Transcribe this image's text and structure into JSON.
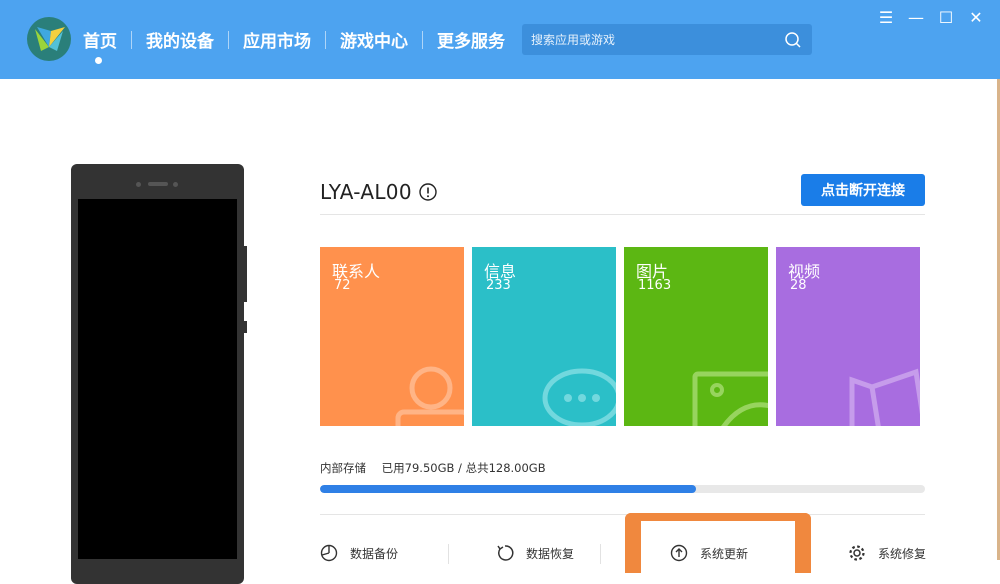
{
  "nav": {
    "items": [
      {
        "label": "首页"
      },
      {
        "label": "我的设备"
      },
      {
        "label": "应用市场"
      },
      {
        "label": "游戏中心"
      },
      {
        "label": "更多服务"
      }
    ]
  },
  "search": {
    "placeholder": "搜索应用或游戏"
  },
  "window_controls": {
    "menu": "☰",
    "minimize": "—",
    "maximize": "☐",
    "close": "✕"
  },
  "device": {
    "name": "LYA-AL00",
    "disconnect_label": "点击断开连接"
  },
  "tiles": [
    {
      "label": "联系人",
      "count": "72",
      "color": "#ff914d"
    },
    {
      "label": "信息",
      "count": "233",
      "color": "#2bbfc8"
    },
    {
      "label": "图片",
      "count": "1163",
      "color": "#5cb713"
    },
    {
      "label": "视频",
      "count": "28",
      "color": "#a86de0"
    }
  ],
  "storage": {
    "label": "内部存储",
    "usage": "已用79.50GB / 总共128.00GB",
    "used_fraction": 0.621
  },
  "tools": [
    {
      "label": "数据备份",
      "icon": "backup-icon"
    },
    {
      "label": "数据恢复",
      "icon": "restore-icon"
    },
    {
      "label": "系统更新",
      "icon": "update-icon"
    },
    {
      "label": "系统修复",
      "icon": "repair-icon"
    }
  ],
  "colors": {
    "header": "#4da3f0",
    "accent": "#1a7de8",
    "highlight": "#f0883e"
  }
}
